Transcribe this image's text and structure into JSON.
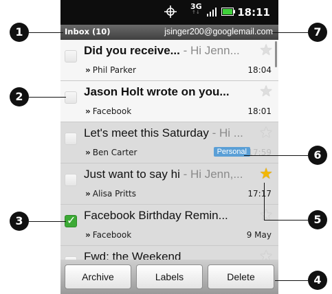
{
  "status_bar": {
    "time": "18:11",
    "network": "3G",
    "icons": [
      "gps-icon",
      "3g-icon",
      "signal-icon",
      "battery-icon"
    ]
  },
  "inbox_bar": {
    "title": "Inbox (10)",
    "account": "jsinger200@googlemail.com"
  },
  "messages": [
    {
      "subject": "Did you receive...",
      "snippet": " - Hi Jenn...",
      "from": "Phil Parker",
      "time": "18:04",
      "unread": true,
      "starred": false,
      "checked": false,
      "label": ""
    },
    {
      "subject": "Jason Holt wrote on you...",
      "snippet": "",
      "from": "Facebook",
      "time": "18:01",
      "unread": true,
      "starred": false,
      "checked": false,
      "label": ""
    },
    {
      "subject": "Let's meet this Saturday",
      "snippet": " - Hi ...",
      "from": "Ben Carter",
      "time": "17:59",
      "unread": false,
      "starred": false,
      "checked": false,
      "label": "Personal"
    },
    {
      "subject": "Just want to say hi",
      "snippet": " - Hi Jenn,...",
      "from": "Alisa Pritts",
      "time": "17:17",
      "unread": false,
      "starred": true,
      "checked": false,
      "label": ""
    },
    {
      "subject": "Facebook Birthday Remin...",
      "snippet": "",
      "from": "Facebook",
      "time": "9 May",
      "unread": false,
      "starred": false,
      "checked": true,
      "label": ""
    }
  ],
  "partial_row": {
    "subject": "Fwd: the Weekend"
  },
  "from_prefix": "»",
  "actions": {
    "archive": "Archive",
    "labels": "Labels",
    "delete": "Delete"
  },
  "callouts": [
    "1",
    "2",
    "3",
    "4",
    "5",
    "6",
    "7"
  ],
  "colors": {
    "star_on": "#f2b705",
    "label_chip": "#5a9fd6",
    "checkbox_checked": "#3ca935"
  }
}
